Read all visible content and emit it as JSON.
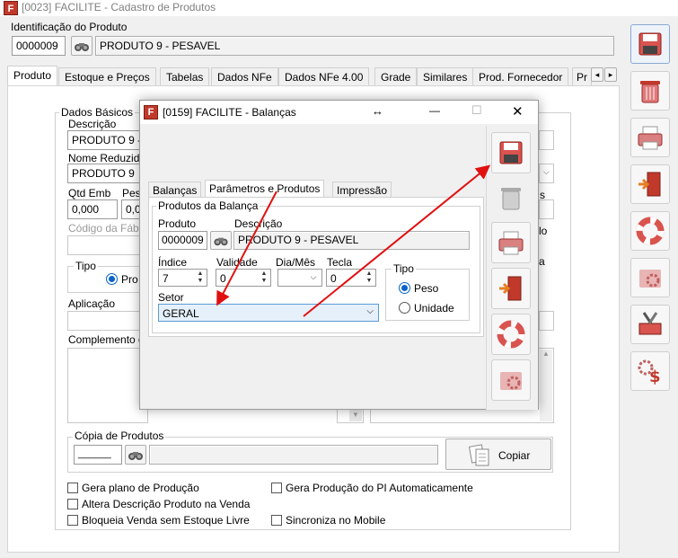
{
  "main_window": {
    "title": "[0023] FACILITE - Cadastro de Produtos",
    "app_icon": "F"
  },
  "identification": {
    "label": "Identificação do Produto",
    "code": "0000009",
    "name": "PRODUTO 9 - PESAVEL"
  },
  "tabs": [
    {
      "label": "Produto"
    },
    {
      "label": "Estoque e Preços"
    },
    {
      "label": "Tabelas"
    },
    {
      "label": "Dados NFe"
    },
    {
      "label": "Dados NFe 4.00"
    },
    {
      "label": "Grade"
    },
    {
      "label": "Similares"
    },
    {
      "label": "Prod. Fornecedor"
    },
    {
      "label": "Pr"
    }
  ],
  "tab_scroll": {
    "left": "◂",
    "right": "▸"
  },
  "produto_tab": {
    "dados_basicos": "Dados Básicos",
    "descricao_label": "Descrição",
    "descricao_value": "PRODUTO 9 -",
    "nome_reduzido_label": "Nome Reduzid",
    "nome_reduzido_value": "PRODUTO 9",
    "qtd_emb_label": "Qtd Emb",
    "qtd_emb_value": "0,000",
    "pes_label": "Pes",
    "pes_value": "0,0",
    "codigo_fabrica_label": "Código da Fáb",
    "tipo_label": "Tipo",
    "tipo_option": "Pro",
    "aplicacao_label": "Aplicação",
    "complemento_label": "Complemento d",
    "copia_label": "Cópia de Produtos",
    "copia_value": "______",
    "copiar_button": "Copiar",
    "checkboxes": [
      {
        "label": "Gera plano de Produção"
      },
      {
        "label": "Gera Produção do PI Automaticamente"
      },
      {
        "label": "Altera Descrição Produto na Venda"
      },
      {
        "label": "Bloqueia Venda sem Estoque Livre"
      },
      {
        "label": "Sincroniza no Mobile"
      }
    ],
    "right_partials": [
      "s",
      "lo",
      "a"
    ]
  },
  "dialog": {
    "title": "[0159] FACILITE - Balanças",
    "app_icon": "F",
    "move_glyph": "↔",
    "controls": {
      "minimize": "—",
      "maximize": "☐",
      "close": "✕"
    },
    "tabs": [
      {
        "label": "Balanças"
      },
      {
        "label": "Parâmetros e Produtos"
      },
      {
        "label": "Impressão"
      }
    ],
    "group_title": "Produtos da Balança",
    "produto_label": "Produto",
    "produto_value": "0000009",
    "descricao_label": "Descrição",
    "descricao_value": "PRODUTO 9 - PESAVEL",
    "indice_label": "Índice",
    "indice_value": "7",
    "validade_label": "Validade",
    "validade_value": "0",
    "dia_mes_label": "Dia/Mês",
    "tecla_label": "Tecla",
    "tecla_value": "0",
    "tipo_label": "Tipo",
    "tipo_options": [
      {
        "label": "Peso",
        "selected": true
      },
      {
        "label": "Unidade",
        "selected": false
      }
    ],
    "setor_label": "Setor",
    "setor_value": "GERAL"
  },
  "colors": {
    "annotation_arrow": "#e01010",
    "accent_blue": "#0a64c8",
    "icon_red": "#c0392b"
  }
}
